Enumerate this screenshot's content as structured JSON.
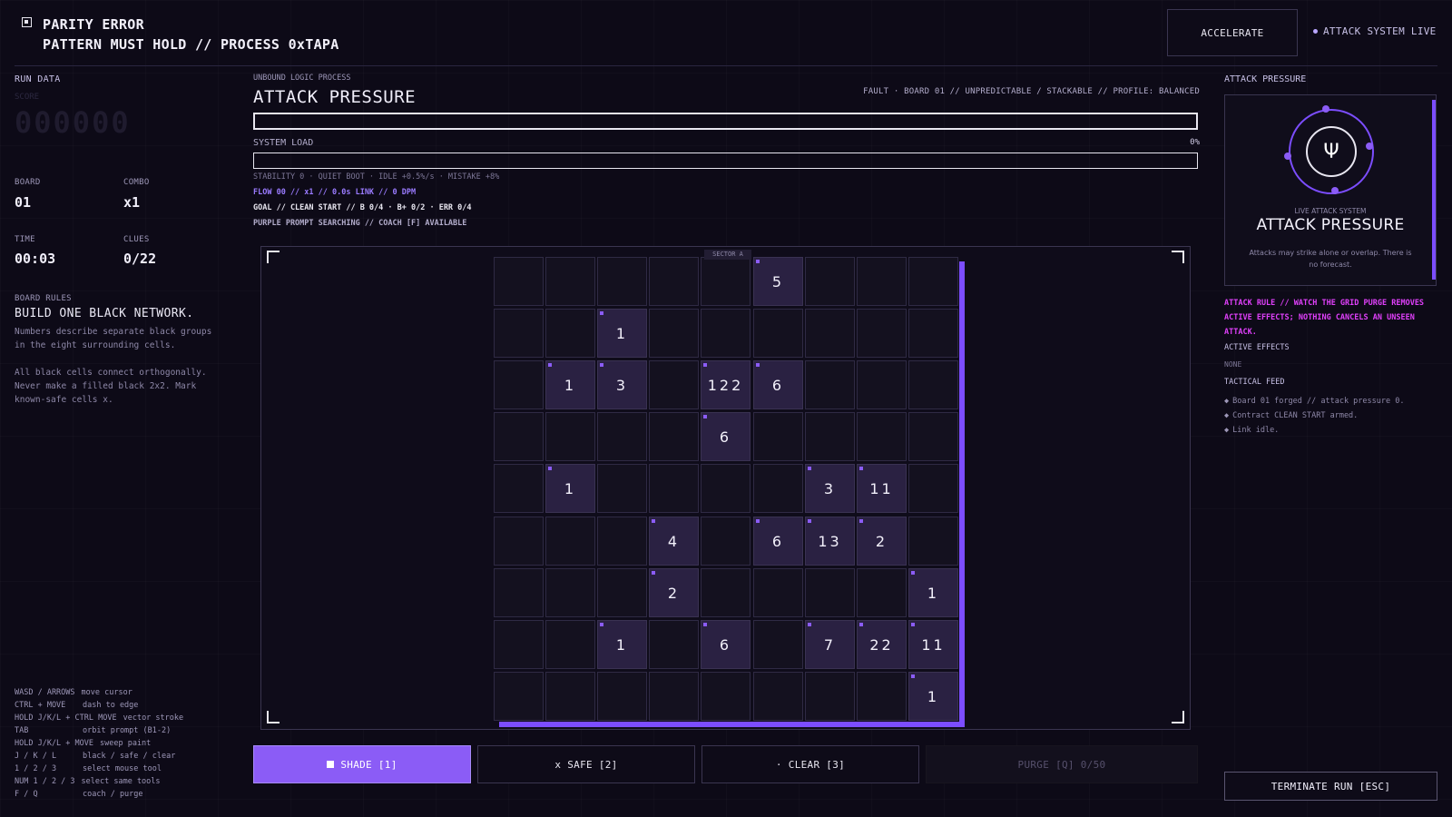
{
  "header": {
    "title": "PARITY ERROR",
    "subtitle": "PATTERN MUST HOLD // PROCESS 0xTAPA",
    "accelerate_label": "ACCELERATE",
    "live_label": "ATTACK SYSTEM LIVE"
  },
  "run_data": {
    "label": "RUN DATA",
    "score_label": "SCORE",
    "score": "000000",
    "board_label": "BOARD",
    "board": "01",
    "combo_label": "COMBO",
    "combo": "x1",
    "time_label": "TIME",
    "time": "00:03",
    "clues_label": "CLUES",
    "clues": "0/22"
  },
  "rules": {
    "label": "BOARD RULES",
    "heading": "BUILD ONE BLACK NETWORK.",
    "p1": "Numbers describe separate black groups in the eight surrounding cells.",
    "p2": "All black cells connect orthogonally. Never make a filled black 2x2. Mark known-safe cells x."
  },
  "keys": [
    [
      "WASD / ARROWS",
      "move cursor"
    ],
    [
      "CTRL + MOVE",
      "dash to edge"
    ],
    [
      "HOLD J/K/L + CTRL MOVE",
      "vector stroke"
    ],
    [
      "TAB",
      "orbit prompt (B1-2)"
    ],
    [
      "HOLD J/K/L + MOVE",
      "sweep paint"
    ],
    [
      "J / K / L",
      "black / safe / clear"
    ],
    [
      "1 / 2 / 3",
      "select mouse tool"
    ],
    [
      "NUM 1 / 2 / 3",
      "select same tools"
    ],
    [
      "F / Q",
      "coach / purge"
    ]
  ],
  "center": {
    "process_label": "UNBOUND LOGIC PROCESS",
    "title": "ATTACK PRESSURE",
    "fault": "FAULT · BOARD 01 // UNPREDICTABLE / STACKABLE // PROFILE: BALANCED",
    "attack_pressure": 0,
    "load_label": "SYSTEM LOAD",
    "load_pct": "0%",
    "system_load": 0,
    "stability": "STABILITY 0 · QUIET BOOT · IDLE +0.5%/s · MISTAKE +8%",
    "flow": "FLOW 00 // x1 // 0.0s LINK // 0 DPM",
    "goal": "GOAL // CLEAN START // B 0/4 · B+ 0/2 · ERR 0/4",
    "prompt": "PURPLE PROMPT SEARCHING // COACH [F] AVAILABLE",
    "sector": "SECTOR A"
  },
  "board": {
    "rows": 9,
    "cols": 9,
    "clues": [
      {
        "r": 0,
        "c": 5,
        "v": "5"
      },
      {
        "r": 1,
        "c": 2,
        "v": "1"
      },
      {
        "r": 2,
        "c": 1,
        "v": "1"
      },
      {
        "r": 2,
        "c": 2,
        "v": "3"
      },
      {
        "r": 2,
        "c": 4,
        "v": "122"
      },
      {
        "r": 2,
        "c": 5,
        "v": "6"
      },
      {
        "r": 3,
        "c": 4,
        "v": "6"
      },
      {
        "r": 4,
        "c": 1,
        "v": "1"
      },
      {
        "r": 4,
        "c": 6,
        "v": "3"
      },
      {
        "r": 4,
        "c": 7,
        "v": "11"
      },
      {
        "r": 5,
        "c": 3,
        "v": "4"
      },
      {
        "r": 5,
        "c": 5,
        "v": "6"
      },
      {
        "r": 5,
        "c": 6,
        "v": "13"
      },
      {
        "r": 5,
        "c": 7,
        "v": "2"
      },
      {
        "r": 6,
        "c": 3,
        "v": "2"
      },
      {
        "r": 6,
        "c": 8,
        "v": "1"
      },
      {
        "r": 7,
        "c": 2,
        "v": "1"
      },
      {
        "r": 7,
        "c": 4,
        "v": "6"
      },
      {
        "r": 7,
        "c": 6,
        "v": "7"
      },
      {
        "r": 7,
        "c": 7,
        "v": "22"
      },
      {
        "r": 7,
        "c": 8,
        "v": "11"
      },
      {
        "r": 8,
        "c": 8,
        "v": "1"
      }
    ]
  },
  "actions": {
    "shade": "SHADE [1]",
    "safe": "x SAFE [2]",
    "clear": "· CLEAR [3]",
    "purge": "PURGE [Q]  0/50"
  },
  "right_panel": {
    "title": "ATTACK PRESSURE",
    "glyph": "Ψ",
    "live_system": "LIVE ATTACK SYSTEM",
    "big_title": "ATTACK PRESSURE",
    "desc": "Attacks may strike alone or overlap. There is no forecast.",
    "attack_rule": "ATTACK RULE // WATCH THE GRID PURGE REMOVES ACTIVE EFFECTS; NOTHING CANCELS AN UNSEEN ATTACK.",
    "active_effects_label": "ACTIVE EFFECTS",
    "active_effects": "NONE",
    "tactical_label": "TACTICAL FEED",
    "feed": [
      "Board 01 forged // attack pressure 0.",
      "Contract CLEAN START armed.",
      "Link idle."
    ],
    "terminate": "TERMINATE RUN [ESC]"
  },
  "colors": {
    "accent": "#8b5cf6",
    "accent_bright": "#7c4dff",
    "magenta": "#e040fb",
    "background": "#0d0a17"
  },
  "icons": {
    "header": "chip-icon",
    "live": "status-dot-icon",
    "orbit": "trident-icon"
  }
}
